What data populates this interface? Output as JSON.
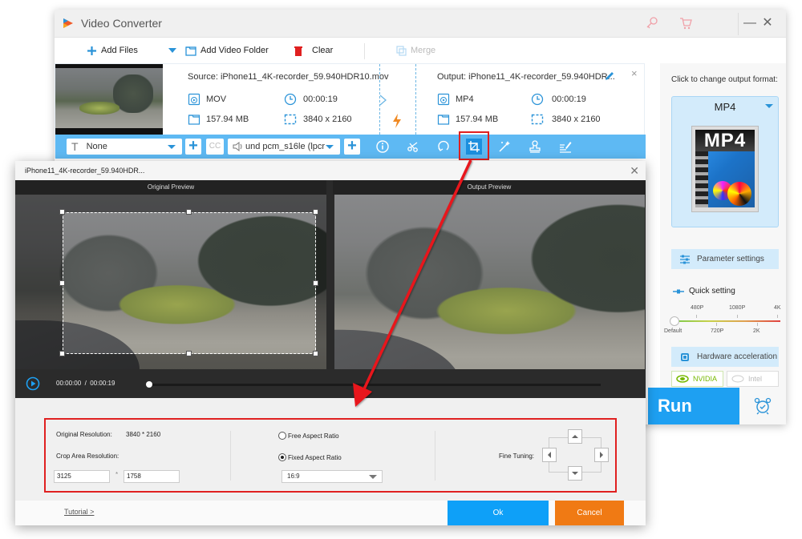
{
  "app": {
    "title": "Video Converter",
    "window_controls": {
      "minimize": "—",
      "close": "✕"
    }
  },
  "toolbar": {
    "add_files": "Add Files",
    "add_video_folder": "Add Video Folder",
    "clear": "Clear",
    "merge": "Merge"
  },
  "file": {
    "source_label": "Source: iPhone11_4K-recorder_59.940HDR10.mov",
    "output_label": "Output: iPhone11_4K-recorder_59.940HDR...",
    "source": {
      "format": "MOV",
      "duration": "00:00:19",
      "size": "157.94 MB",
      "resolution": "3840 x 2160"
    },
    "output": {
      "format": "MP4",
      "duration": "00:00:19",
      "size": "157.94 MB",
      "resolution": "3840 x 2160"
    },
    "close_icon": "×"
  },
  "edit_bar": {
    "subtitle_select": "None",
    "cc_label": "CC",
    "audio_select": "und pcm_s16le (lpcr",
    "icons": [
      "info-icon",
      "cut-icon",
      "rotate-icon",
      "crop-icon",
      "effects-icon",
      "watermark-icon",
      "edit-subtitle-icon"
    ],
    "active_icon": "crop-icon"
  },
  "right_panel": {
    "change_format_label": "Click to change output format:",
    "format": "MP4",
    "format_icon_text": "MP4",
    "parameter_settings": "Parameter settings",
    "quick_setting": "Quick setting",
    "quality_ticks_top": [
      "480P",
      "1080P",
      "4K"
    ],
    "quality_ticks_bottom": [
      "Default",
      "720P",
      "2K"
    ],
    "quality_selected": "Default",
    "hardware_acceleration": "Hardware acceleration",
    "gpu_nvidia": "NVIDIA",
    "gpu_intel": "Intel",
    "run": "Run"
  },
  "crop_dialog": {
    "title": "iPhone11_4K-recorder_59.940HDR...",
    "close": "✕",
    "original_preview": "Original Preview",
    "output_preview": "Output Preview",
    "current_time": "00:00:00",
    "time_separator": "/",
    "total_time": "00:00:19",
    "playback_progress": 0,
    "original_resolution_label": "Original Resolution:",
    "original_resolution_value": "3840 * 2160",
    "crop_area_label": "Crop Area Resolution:",
    "crop_width": "3125",
    "crop_separator": "*",
    "crop_height": "1758",
    "free_aspect": "Free Aspect Ratio",
    "fixed_aspect": "Fixed Aspect Ratio",
    "aspect_mode": "fixed",
    "aspect_value": "16:9",
    "fine_tuning_label": "Fine Tuning:",
    "tutorial": "Tutorial >",
    "ok": "Ok",
    "cancel": "Cancel"
  },
  "colors": {
    "accent_blue": "#1ea0f2",
    "edit_bar_blue": "#5eb9f3",
    "cancel_orange": "#f07a14",
    "highlight_red": "#e02020",
    "nvidia_green": "#76b900"
  }
}
